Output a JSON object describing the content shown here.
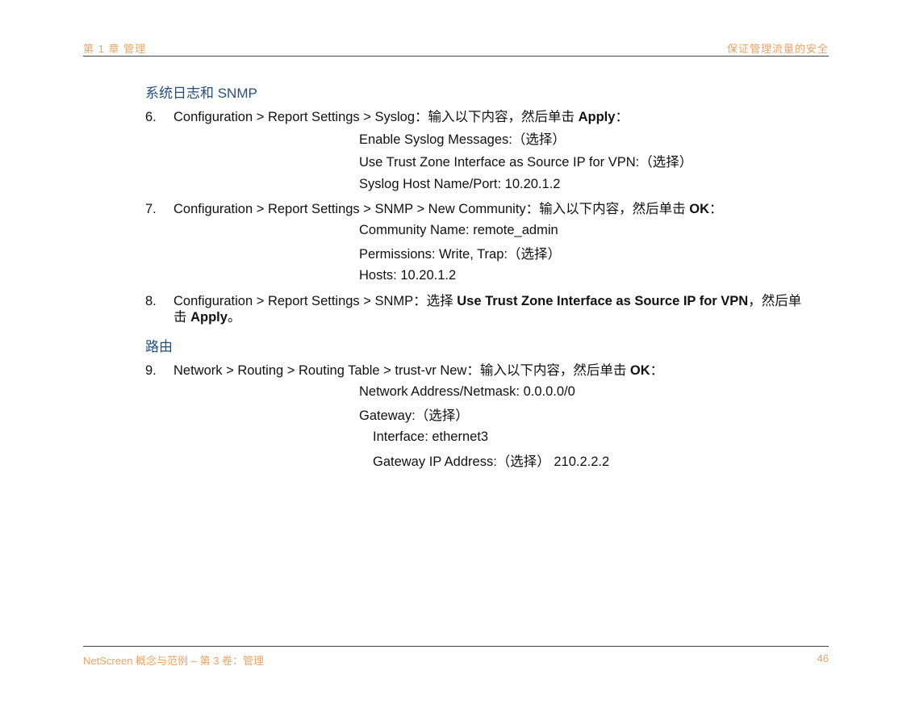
{
  "header": {
    "left": "第 1 章 管理",
    "right": "保证管理流量的安全"
  },
  "sections": [
    {
      "title": "系统日志和 SNMP"
    },
    {
      "title": "路由"
    }
  ],
  "steps": [
    {
      "num": "6.",
      "pre": "Configuration > Report Settings > Syslog：输入以下内容，然后单击 ",
      "bold": "Apply",
      "post": "：",
      "items": [
        "Enable Syslog Messages:（选择）",
        "Use Trust Zone Interface as Source IP for VPN:（选择）",
        "Syslog Host Name/Port: 10.20.1.2"
      ]
    },
    {
      "num": "7.",
      "pre": "Configuration > Report Settings > SNMP > New Community：输入以下内容，然后单击 ",
      "bold": "OK",
      "post": "：",
      "items": [
        "Community Name: remote_admin",
        "Permissions: Write, Trap:（选择）",
        "Hosts: 10.20.1.2"
      ]
    },
    {
      "num": "8.",
      "pre": "Configuration > Report Settings > SNMP：选择 ",
      "bold": "Use Trust Zone Interface as Source IP for VPN",
      "post": "，然后单",
      "line2_pre": "击 ",
      "line2_bold": "Apply",
      "line2_post": "。"
    },
    {
      "num": "9.",
      "pre": "Network > Routing > Routing Table > trust-vr New：输入以下内容，然后单击 ",
      "bold": "OK",
      "post": "：",
      "items": [
        "Network Address/Netmask: 0.0.0.0/0",
        "Gateway:（选择）"
      ],
      "subitems": [
        "Interface: ethernet3",
        "Gateway IP Address:（选择） 210.2.2.2"
      ]
    }
  ],
  "footer": {
    "left": "NetScreen 概念与范例 – 第 3 卷：管理",
    "page": "46"
  },
  "colors": {
    "header": "#e9a468",
    "section": "#234f80"
  }
}
